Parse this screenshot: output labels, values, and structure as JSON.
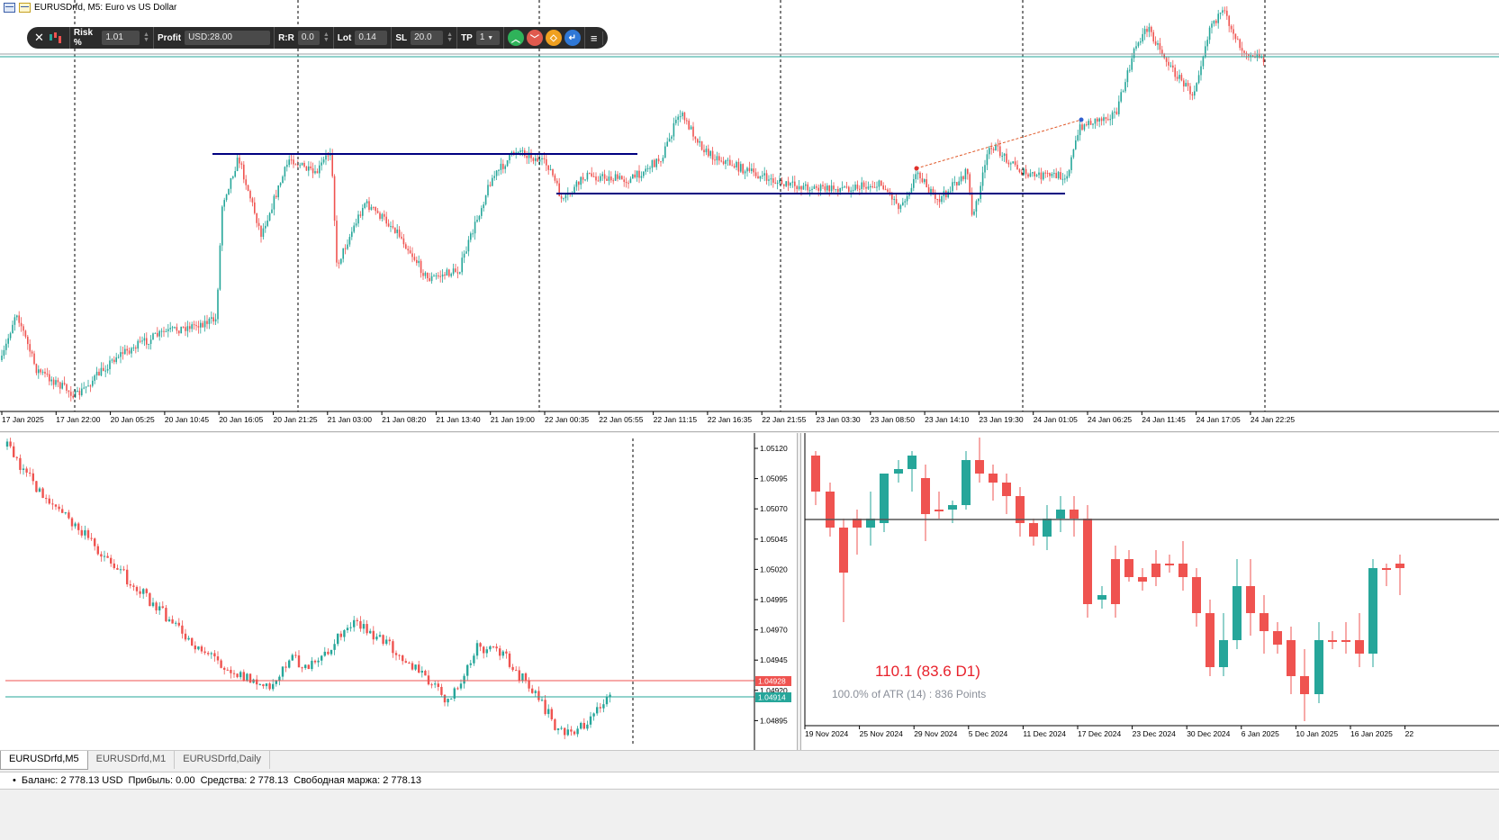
{
  "main_chart": {
    "title": "EURUSDrfd, M5:  Euro vs US Dollar",
    "x_labels": [
      "17 Jan 2025",
      "17 Jan 22:00",
      "20 Jan 05:25",
      "20 Jan 10:45",
      "20 Jan 16:05",
      "20 Jan 21:25",
      "21 Jan 03:00",
      "21 Jan 08:20",
      "21 Jan 13:40",
      "21 Jan 19:00",
      "22 Jan 00:35",
      "22 Jan 05:55",
      "22 Jan 11:15",
      "22 Jan 16:35",
      "22 Jan 21:55",
      "23 Jan 03:30",
      "23 Jan 08:50",
      "23 Jan 14:10",
      "23 Jan 19:30",
      "24 Jan 01:05",
      "24 Jan 06:25",
      "24 Jan 11:45",
      "24 Jan 17:05",
      "24 Jan 22:25"
    ],
    "colors": {
      "bull": "#26a69a",
      "bear": "#ef5350",
      "level_line": "#000080",
      "trend_line": "#e05a2b"
    }
  },
  "toolbar": {
    "risk_label": "Risk %",
    "risk_value": "1.01",
    "profit_label": "Profit",
    "profit_value": "USD:28.00",
    "rr_label": "R:R",
    "rr_value": "0.0",
    "lot_label": "Lot",
    "lot_value": "0.14",
    "sl_label": "SL",
    "sl_value": "20.0",
    "tp_label": "TP",
    "tp_value": "1",
    "icons": [
      "close-icon",
      "profit-chart-icon",
      "buy-icon",
      "sell-icon",
      "pending-icon",
      "send-icon",
      "menu-icon",
      "collapse-icon"
    ],
    "colors": {
      "buy": "#2fb35a",
      "sell": "#e05a4e",
      "pending": "#f0a020",
      "send": "#2f78d6"
    }
  },
  "m1_chart": {
    "price_labels": [
      "1.05120",
      "1.05095",
      "1.05070",
      "1.05045",
      "1.05020",
      "1.04995",
      "1.04970",
      "1.04945",
      "1.04920",
      "1.04895"
    ],
    "ask_tag": "1.04928",
    "bid_tag": "1.04914",
    "colors": {
      "ask": "#ef5350",
      "bid": "#26a69a"
    }
  },
  "daily_chart": {
    "atr_value": "110.1 (83.6 D1)",
    "atr_subtext": "100.0% of ATR (14) : 836 Points",
    "x_labels": [
      "19 Nov 2024",
      "25 Nov 2024",
      "29 Nov 2024",
      "5 Dec 2024",
      "11 Dec 2024",
      "17 Dec 2024",
      "23 Dec 2024",
      "30 Dec 2024",
      "6 Jan 2025",
      "10 Jan 2025",
      "16 Jan 2025",
      "22"
    ]
  },
  "tabs": [
    "EURUSDrfd,M5",
    "EURUSDrfd,M1",
    "EURUSDrfd,Daily"
  ],
  "status": {
    "balance": "Баланс: 2 778.13 USD",
    "profit": "Прибыль: 0.00",
    "equity": "Средства: 2 778.13",
    "free_margin": "Свободная маржа: 2 778.13"
  }
}
